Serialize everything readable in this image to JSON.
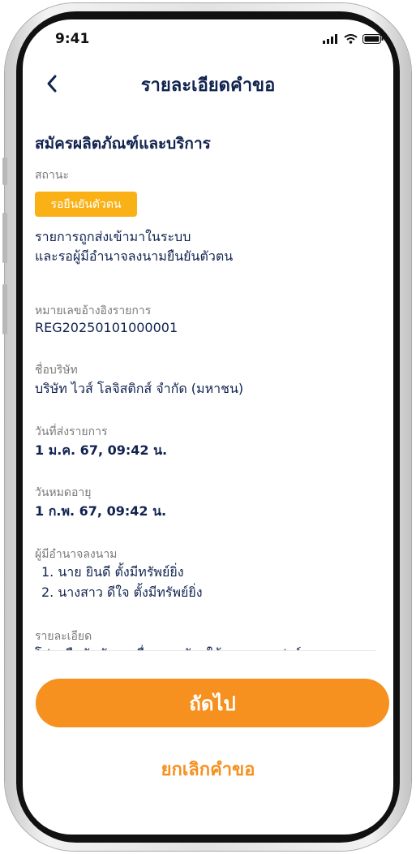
{
  "status_bar": {
    "time": "9:41"
  },
  "header": {
    "title": "รายละเอียดคำขอ"
  },
  "request": {
    "service_title": "สมัครผลิตภัณฑ์และบริการ",
    "status_label": "สถานะ",
    "status_badge": "รอยืนยันตัวตน",
    "status_desc_line1": "รายการถูกส่งเข้ามาในระบบ",
    "status_desc_line2": "และรอผู้มีอำนาจลงนามยืนยันตัวตน",
    "reference_label": "หมายเลขอ้างอิงรายการ",
    "reference_value": "REG20250101000001",
    "company_label": "ชื่อบริษัท",
    "company_value": "บริษัท ไวส์ โลจิสติกส์ จำกัด (มหาชน)",
    "submitted_label": "วันที่ส่งรายการ",
    "submitted_value": "1 ม.ค. 67, 09:42 น.",
    "expiry_label": "วันหมดอายุ",
    "expiry_value": "1 ก.พ. 67, 09:42 น.",
    "signers_label": "ผู้มีอำนาจลงนาม",
    "signers": [
      "1. นาย ยินดี ตั้งมีทรัพย์ยิ่ง",
      "2. นางสาว ดีใจ ตั้งมีทรัพย์ยิ่ง"
    ],
    "details_label": "รายละเอียด",
    "details_value": "โปรดยืนยันตัวตนเพื่อการสมัครใช้งานแพลตฟอร์ม"
  },
  "actions": {
    "next_label": "ถัดไป",
    "cancel_label": "ยกเลิกคำขอ"
  },
  "colors": {
    "accent": "#f6901e",
    "badge": "#f9b115",
    "title": "#10234f"
  },
  "icons": [
    "back-icon",
    "signal-icon",
    "wifi-icon",
    "battery-icon"
  ]
}
